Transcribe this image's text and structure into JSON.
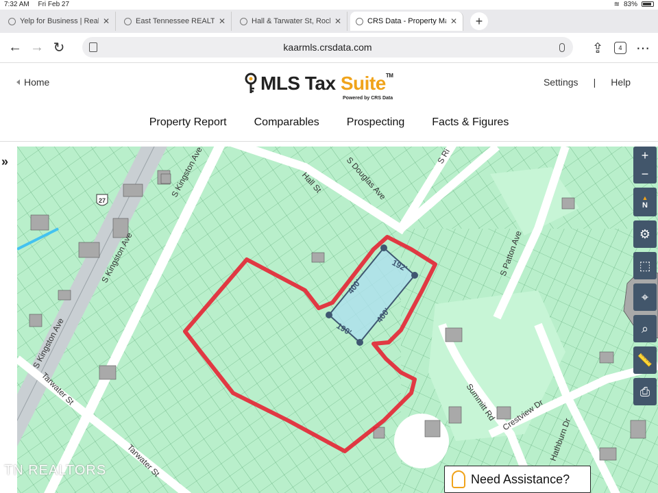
{
  "status": {
    "time": "7:32 AM",
    "date": "Fri Feb 27",
    "battery": "83%"
  },
  "tabs": [
    {
      "title": "Yelp for Business | Real E",
      "active": false
    },
    {
      "title": "East Tennessee REALTOR",
      "active": false
    },
    {
      "title": "Hall & Tarwater St, Rockf",
      "active": false
    },
    {
      "title": "CRS Data - Property Map",
      "active": true
    }
  ],
  "toolbar": {
    "url": "kaarmls.crsdata.com",
    "tab_count": "4"
  },
  "header": {
    "home_label": "Home",
    "logo_part1": "MLS Tax ",
    "logo_part2": "Suite",
    "logo_tm": "TM",
    "powered_by": "Powered by CRS Data",
    "settings_label": "Settings",
    "separator": "|",
    "help_label": "Help"
  },
  "nav": [
    "Property Report",
    "Comparables",
    "Prospecting",
    "Facts & Figures"
  ],
  "map": {
    "streets": [
      "S Kingston Ave",
      "S Kingston Ave",
      "S Kingston Ave",
      "Hall St",
      "S Douglas Ave",
      "S Ri",
      "S Patton Ave",
      "Tarwater St",
      "Tarwater St",
      "Summitt Rd",
      "Crestview Dr",
      "Hathburn Dr"
    ],
    "highway": "27",
    "measurements": [
      "192'",
      "400'",
      "400'",
      "190'"
    ],
    "colors": {
      "parcel_fill": "#b9efcb",
      "outline": "#e8192c",
      "selection": "#aee0ee",
      "street": "#ffffff"
    }
  },
  "controls": {
    "zoom_in": "+",
    "zoom_out": "−",
    "compass": "N"
  },
  "assistance_label": "Need Assistance?",
  "watermark": "TN REALTORS"
}
